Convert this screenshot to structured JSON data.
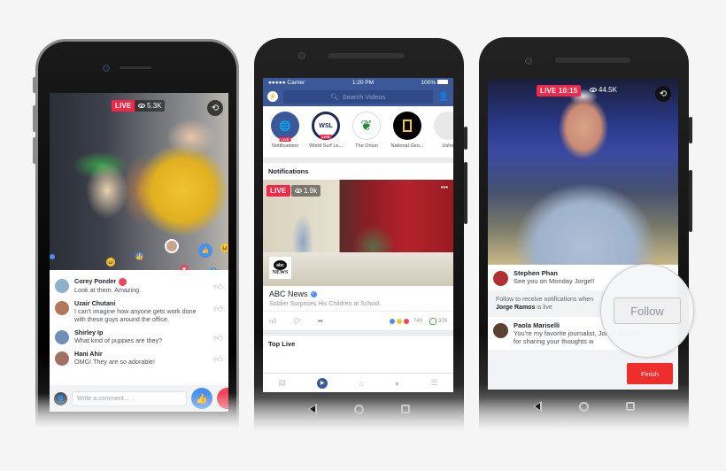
{
  "phone1": {
    "live_label": "LIVE",
    "viewers": "5.3K",
    "comments": [
      {
        "name": "Corey Ponder",
        "text": "Look at them. Amazing.",
        "avatar_color": "#8fb0c9",
        "reaction": "heart"
      },
      {
        "name": "Uzair Chutani",
        "text": "I can't imagine how anyone gets work done with these guys around the office.",
        "avatar_color": "#b07a5a"
      },
      {
        "name": "Shirley Ip",
        "text": "What kind of puppies are they?",
        "avatar_color": "#6f8fb8"
      },
      {
        "name": "Hani Ahir",
        "text": "OMG! They are so adorable!",
        "avatar_color": "#a07060"
      }
    ],
    "comment_placeholder": "Write a comment..."
  },
  "phone2": {
    "status": {
      "signal": "●●●●● Carrier",
      "time": "1:20 PM",
      "battery": "100%"
    },
    "search_placeholder": "Search Videos",
    "pages": [
      {
        "label": "Notifications",
        "color": "#3b5998",
        "live": true,
        "glyph": "🌐"
      },
      {
        "label": "World Surf Le...",
        "color": "#1e2a52",
        "live": true,
        "glyph": "WSL"
      },
      {
        "label": "The Onion",
        "color": "#ffffff",
        "live": false,
        "glyph": "🧅"
      },
      {
        "label": "National Geo...",
        "color": "#000000",
        "live": false,
        "glyph": "▯"
      },
      {
        "label": "Ushe",
        "color": "#e8e8e8",
        "live": false,
        "glyph": ""
      }
    ],
    "live_badge": "LIVE",
    "notifications_title": "Notifications",
    "video": {
      "live_label": "LIVE",
      "viewers": "1.9k",
      "more": "•••",
      "logo_top": "abc",
      "logo_bottom": "NEWS"
    },
    "post": {
      "author": "ABC News",
      "caption": "Soldier Surprises His Children at School.",
      "reaction_count": "749",
      "comment_count": "378"
    },
    "top_live_title": "Top Live",
    "tabs": [
      "news-feed",
      "video",
      "marketplace",
      "notifications",
      "menu"
    ],
    "active_tab": "video"
  },
  "phone3": {
    "live_label": "LIVE 10:15",
    "viewers": "44.5K",
    "comments": [
      {
        "name": "Stephen Phan",
        "text": "See you on Monday Jorge!!",
        "avatar_color": "#b03030"
      },
      {
        "name": "Paola Mariselli",
        "text": "You're my favorite journalist, Jorge! Thanks for sharing your thoughts w",
        "avatar_color": "#5a4030"
      }
    ],
    "follow_prompt": "Follow to receive notifications when",
    "follow_name": "Jorge Ramos",
    "follow_suffix": " is live",
    "follow_label": "Follow",
    "finish_label": "Finish"
  },
  "colors": {
    "facebook_blue": "#3b5998",
    "live_red": "#f02849",
    "like_blue": "#4a8ff0",
    "finish_red": "#f02d2d"
  }
}
